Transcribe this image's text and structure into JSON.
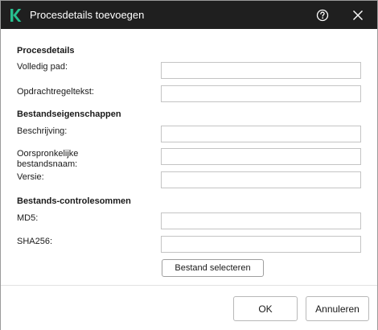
{
  "window": {
    "title": "Procesdetails toevoegen",
    "logo_icon": "kaspersky-k-icon",
    "help_icon": "help-icon",
    "close_icon": "close-icon"
  },
  "sections": {
    "process": {
      "title": "Procesdetails",
      "full_path_label": "Volledig pad:",
      "full_path_value": "",
      "command_line_label": "Opdrachtregeltekst:",
      "command_line_value": ""
    },
    "file_properties": {
      "title": "Bestandseigenschappen",
      "description_label": "Beschrijving:",
      "description_value": "",
      "original_filename_label": "Oorspronkelijke bestandsnaam:",
      "original_filename_value": "",
      "version_label": "Versie:",
      "version_value": ""
    },
    "checksums": {
      "title": "Bestands-controlesommen",
      "md5_label": "MD5:",
      "md5_value": "",
      "sha256_label": "SHA256:",
      "sha256_value": "",
      "select_file_label": "Bestand selecteren"
    }
  },
  "footer": {
    "ok_label": "OK",
    "cancel_label": "Annuleren"
  },
  "colors": {
    "titlebar_bg": "#1f1f1f",
    "logo_green": "#27c08f"
  }
}
